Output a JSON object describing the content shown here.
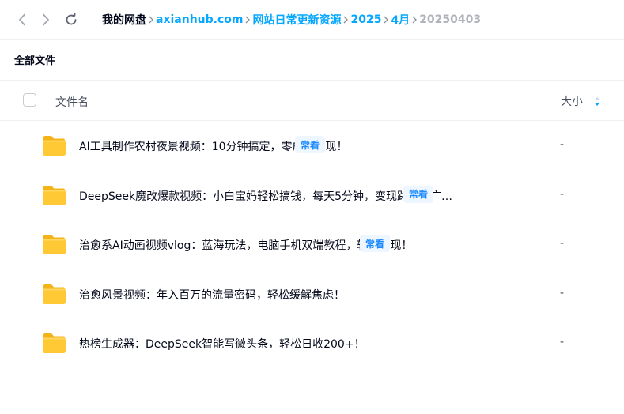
{
  "breadcrumb": {
    "root": "我的网盘",
    "items": [
      "axianhub.com",
      "网站日常更新资源",
      "2025",
      "4月"
    ],
    "current": "20250403"
  },
  "section_title": "全部文件",
  "table": {
    "col_name": "文件名",
    "col_size": "大小"
  },
  "files": [
    {
      "name": "AI工具制作农村夜景视频：10分钟搞定，零成本变现！",
      "badge": "常看",
      "size": "-"
    },
    {
      "name": "DeepSeek魔改爆款视频：小白宝妈轻松搞钱，每天5分钟，变现路子超广…",
      "badge": "常看",
      "size": "-"
    },
    {
      "name": "治愈系AI动画视频vlog：蓝海玩法，电脑手机双端教程，轻松变现！",
      "badge": "常看",
      "size": "-"
    },
    {
      "name": "治愈风景视频：年入百万的流量密码，轻松缓解焦虑！",
      "badge": "",
      "size": "-"
    },
    {
      "name": "热榜生成器：DeepSeek智能写微头条，轻松日收200+！",
      "badge": "",
      "size": "-"
    }
  ],
  "colors": {
    "accent": "#06a7ff",
    "badge_text": "#1d8bff",
    "badge_bg": "#eef6ff",
    "folder": "#ffc936"
  },
  "icons": {
    "back": "chevron-left-icon",
    "forward": "chevron-right-icon",
    "refresh": "refresh-icon",
    "folder": "folder-icon",
    "sort": "sort-icon"
  }
}
